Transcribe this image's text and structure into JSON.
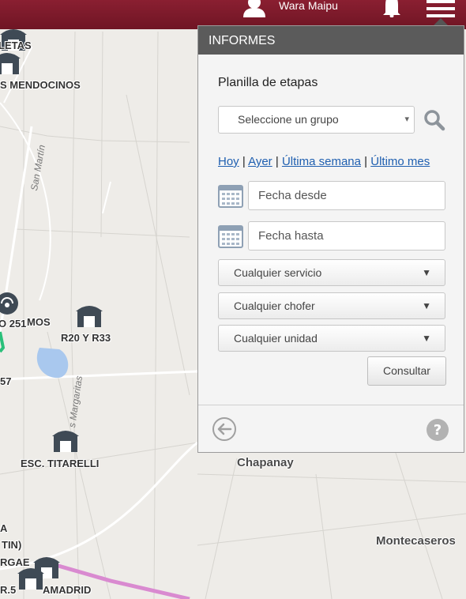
{
  "header": {
    "user_name": "Wara Maipu"
  },
  "panel": {
    "heading": "INFORMES",
    "report_title": "Planilla de etapas",
    "group_select": {
      "value": "Seleccione un grupo",
      "arrow": "▾"
    },
    "quick_links": {
      "today": "Hoy",
      "yesterday": "Ayer",
      "last_week": "Última semana",
      "last_month": "Último mes",
      "separator": "|"
    },
    "date_from_placeholder": "Fecha desde",
    "date_to_placeholder": "Fecha hasta",
    "service_select": {
      "value": "Cualquier servicio",
      "arrow": "▼"
    },
    "driver_select": {
      "value": "Cualquier chofer",
      "arrow": "▼"
    },
    "unit_select": {
      "value": "Cualquier unidad",
      "arrow": "▼"
    },
    "consult_label": "Consultar"
  },
  "map": {
    "markers": [
      {
        "label": "LETAS"
      },
      {
        "label": "S MENDOCINOS"
      },
      {
        "label": "O 251"
      },
      {
        "label": "MOS"
      },
      {
        "label": "R20 Y R33"
      },
      {
        "label": "57"
      },
      {
        "label": "ESC. TITARELLI"
      },
      {
        "label": "A"
      },
      {
        "label": "TIN)"
      },
      {
        "label": "RGAE"
      },
      {
        "label": "R.5"
      },
      {
        "label": "AMADRID"
      }
    ],
    "places": {
      "chapanay": "Chapanay",
      "montecaseros": "Montecaseros"
    },
    "streets": {
      "san_martin": "San Martín",
      "margaritas": "s Margaritas"
    }
  },
  "colors": {
    "topbar": "#7d1a2b",
    "panel_header": "#5b5b5b",
    "link": "#1f5fb0",
    "route": "#d98ad0"
  },
  "icons": [
    "user-icon",
    "bell-icon",
    "menu-icon",
    "search-icon",
    "calendar-icon",
    "back-arrow-icon",
    "help-icon",
    "store-marker-icon",
    "radio-marker-icon"
  ]
}
